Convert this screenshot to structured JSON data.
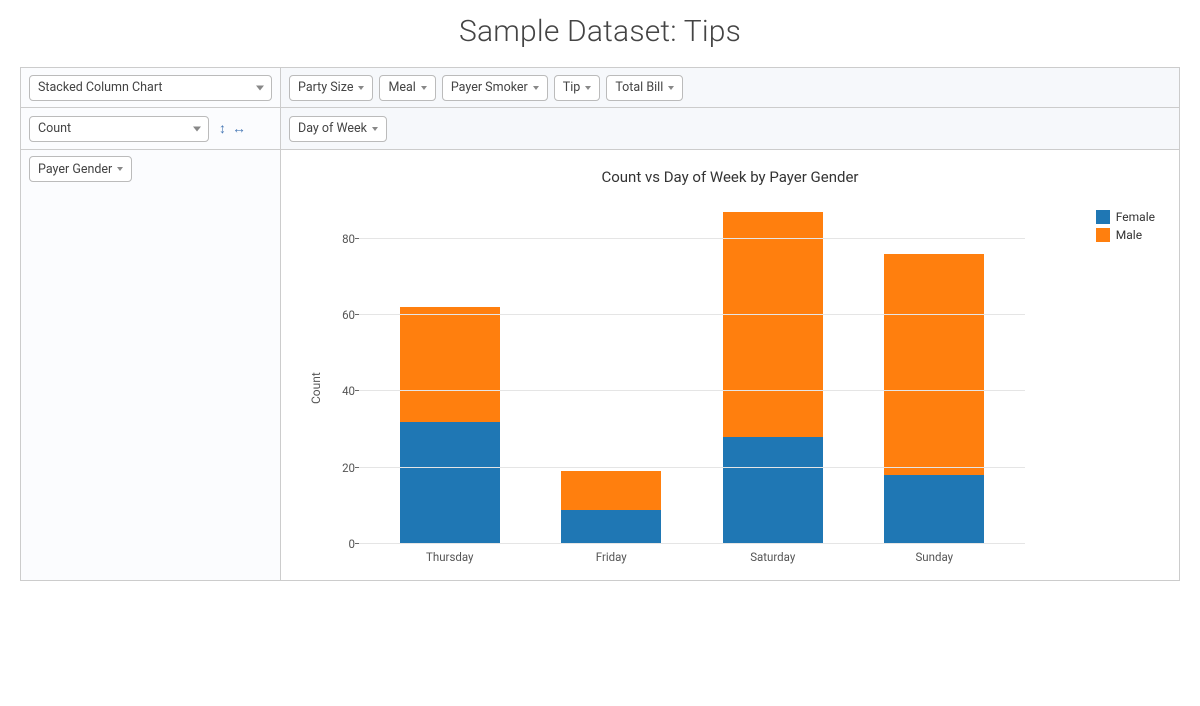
{
  "title": "Sample Dataset: Tips",
  "controls": {
    "chart_type": "Stacked Column Chart",
    "aggregator": "Count",
    "top_fields": [
      "Party Size",
      "Meal",
      "Payer Smoker",
      "Tip",
      "Total Bill"
    ],
    "col_field": "Day of Week",
    "row_field": "Payer Gender"
  },
  "chart_data": {
    "type": "bar",
    "stacked": true,
    "title": "Count vs Day of Week by Payer Gender",
    "ylabel": "Count",
    "xlabel": "",
    "ylim": [
      0,
      88
    ],
    "yticks": [
      0,
      20,
      40,
      60,
      80
    ],
    "categories": [
      "Thursday",
      "Friday",
      "Saturday",
      "Sunday"
    ],
    "series": [
      {
        "name": "Female",
        "values": [
          32,
          9,
          28,
          18
        ],
        "color": "#1f77b4"
      },
      {
        "name": "Male",
        "values": [
          30,
          10,
          59,
          58
        ],
        "color": "#ff7f0e"
      }
    ],
    "legend_position": "right"
  }
}
